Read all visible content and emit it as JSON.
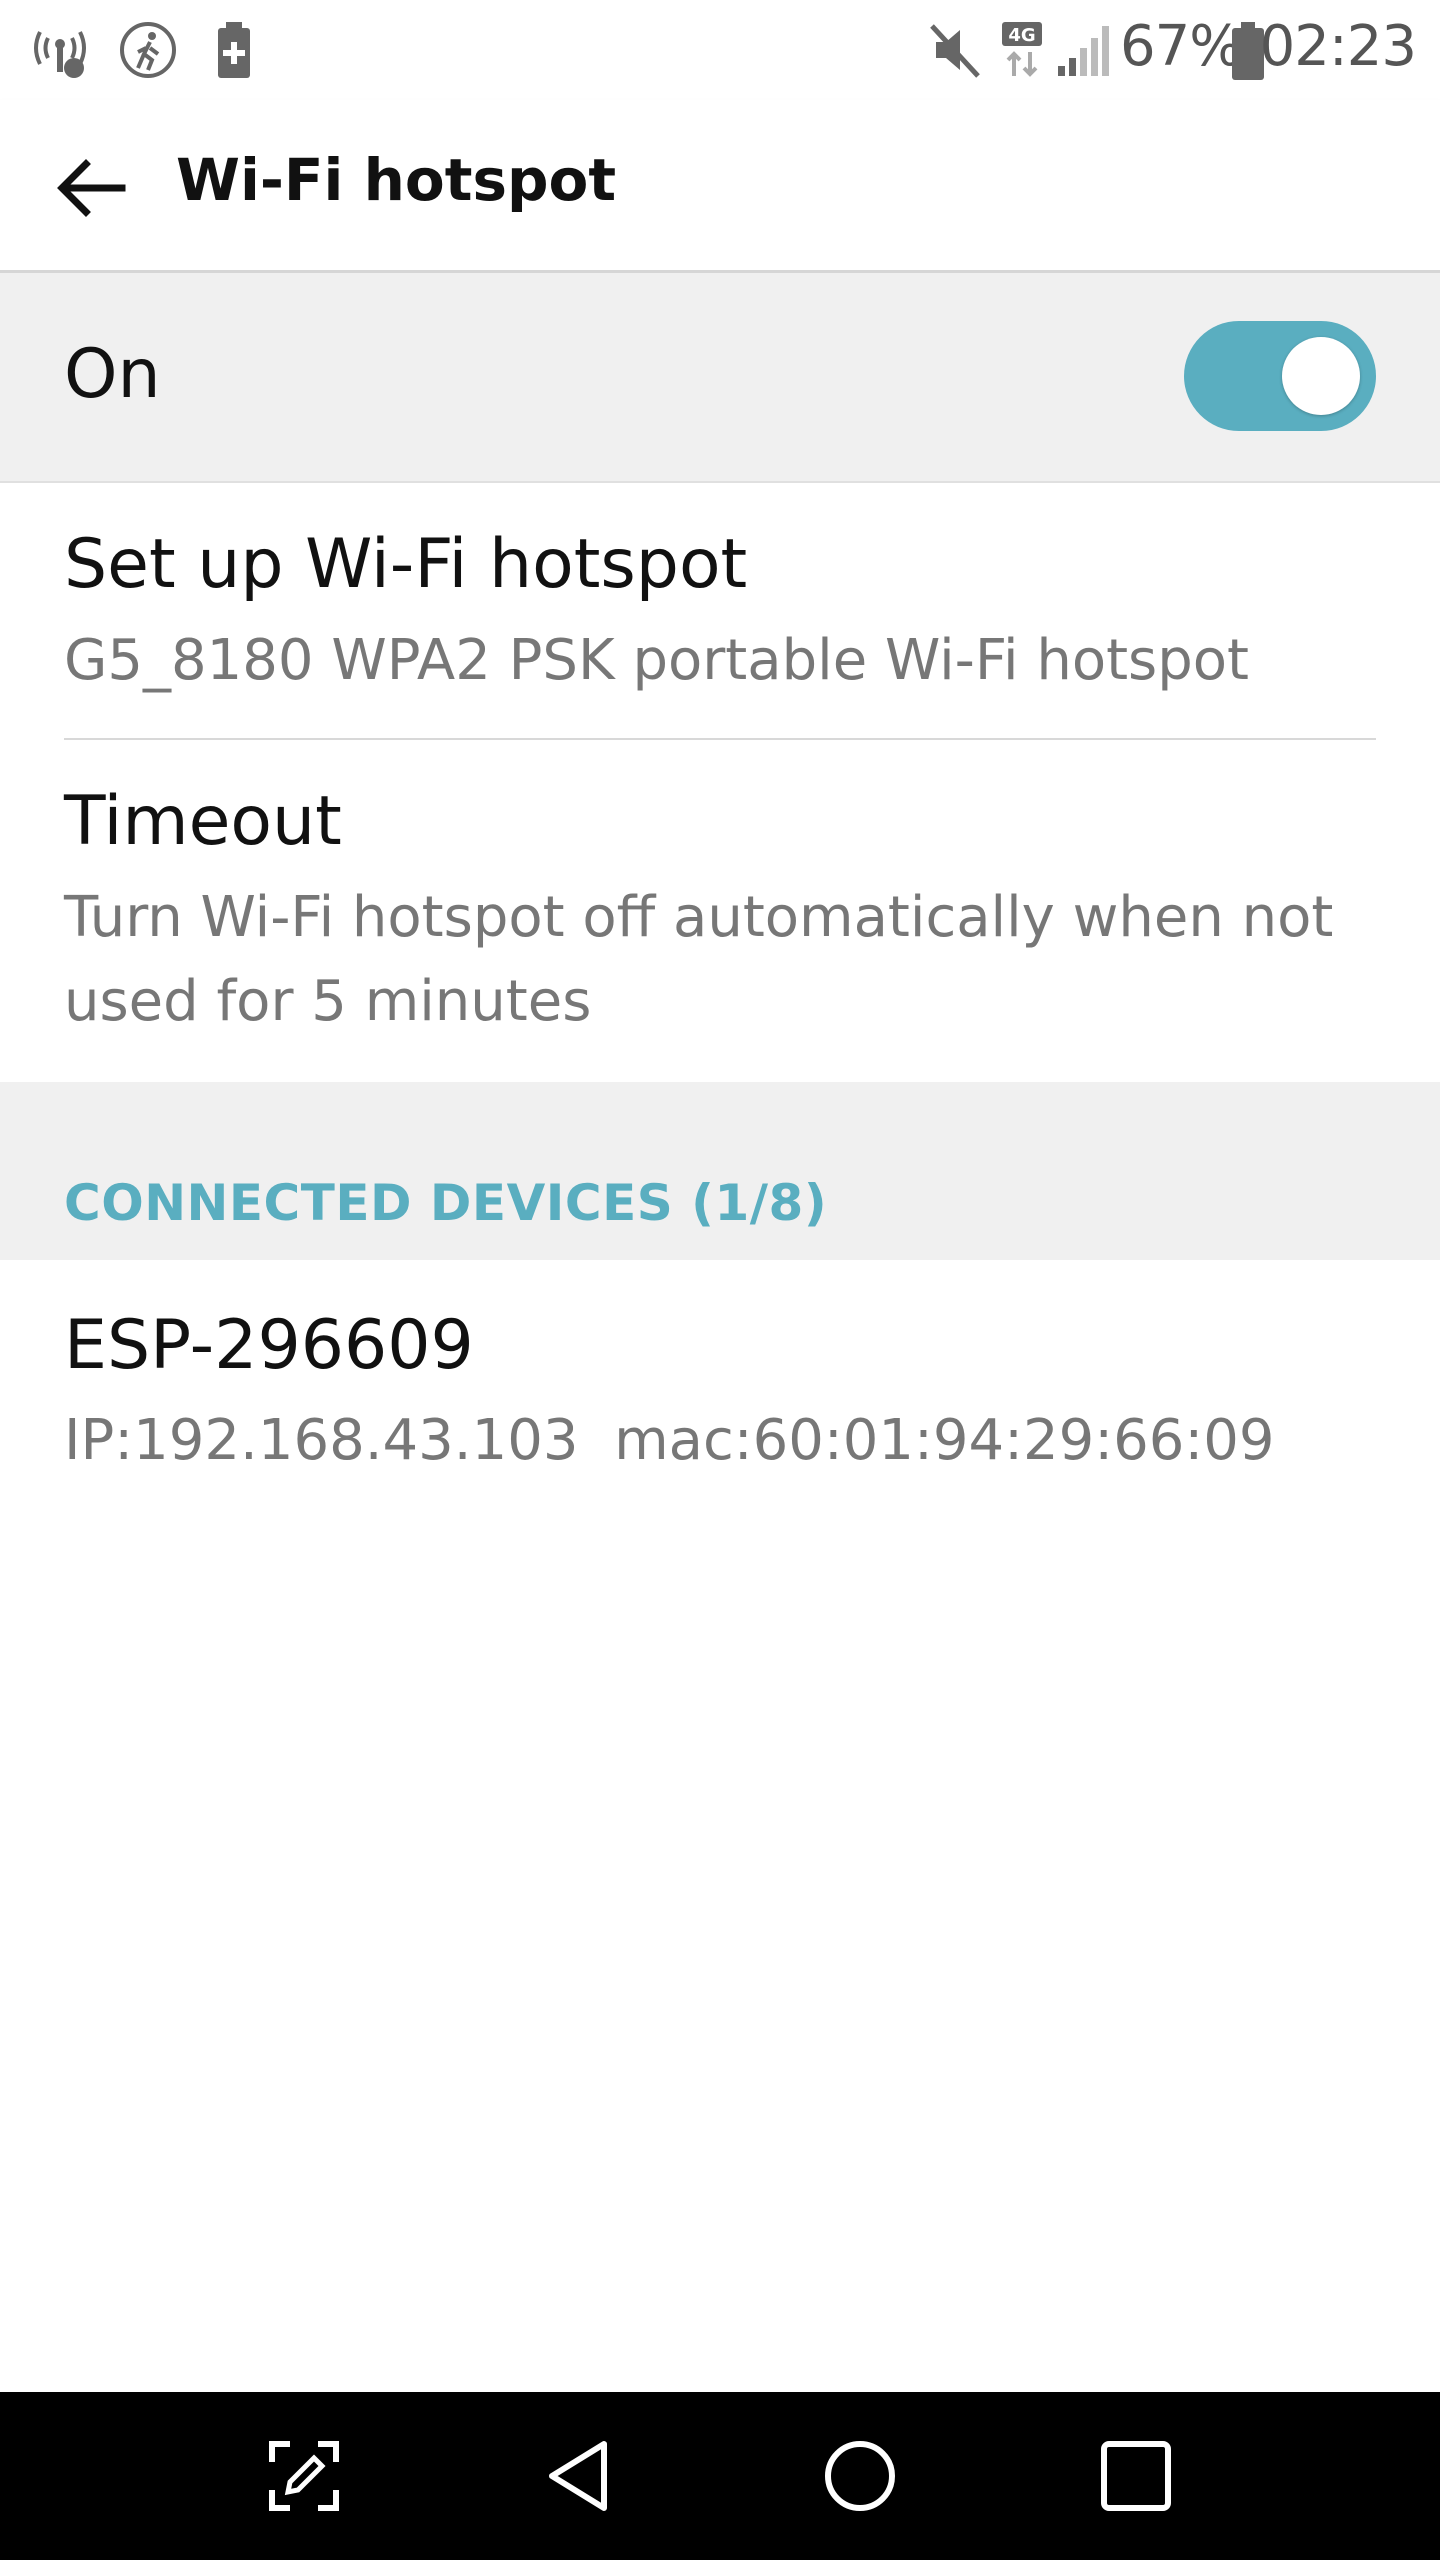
{
  "status_bar": {
    "icons_left": [
      "hotspot-icon",
      "walking-icon",
      "battery-saver-icon"
    ],
    "icons_right": [
      "mute-icon",
      "network-4g-icon",
      "signal-icon",
      "battery-icon"
    ],
    "network_type": "4G",
    "battery_percent": "67%",
    "time": "02:23"
  },
  "app_bar": {
    "title": "Wi-Fi hotspot",
    "back_icon": "arrow-back-icon"
  },
  "master_switch": {
    "label": "On",
    "checked": true,
    "accent_color": "#5aaec0"
  },
  "settings": [
    {
      "title": "Set up Wi-Fi hotspot",
      "summary": "G5_8180 WPA2 PSK portable Wi-Fi hotspot"
    },
    {
      "title": "Timeout",
      "summary": "Turn Wi-Fi hotspot off automatically when not used for 5 minutes"
    }
  ],
  "connected_devices": {
    "header": "CONNECTED DEVICES (1/8)",
    "devices": [
      {
        "name": "ESP-296609",
        "ip": "IP:192.168.43.103",
        "mac": "mac:60:01:94:29:66:09"
      }
    ]
  },
  "nav_bar": {
    "buttons": [
      "edit-screenshot-icon",
      "back-triangle-icon",
      "home-circle-icon",
      "recents-square-icon"
    ]
  }
}
